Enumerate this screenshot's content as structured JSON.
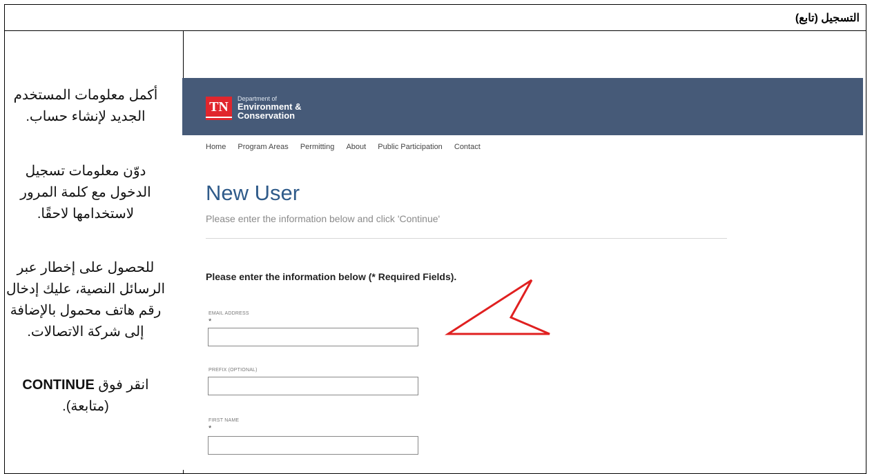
{
  "section_title": "التسجيل (تابع)",
  "instructions": {
    "p1": "أكمل معلومات المستخدم الجديد لإنشاء حساب.",
    "p2": "دوّن معلومات تسجيل الدخول مع كلمة المرور لاستخدامها لاحقًا.",
    "p3": "للحصول على إخطار عبر الرسائل النصية، عليك إدخال رقم هاتف محمول بالإضافة إلى شركة الاتصالات.",
    "p4_prefix": "انقر فوق",
    "p4_bold": "CONTINUE",
    "p4_suffix": "(متابعة)."
  },
  "screenshot": {
    "logo_text": "TN",
    "dept_line1": "Department of",
    "dept_line2": "Environment &",
    "dept_line3": "Conservation",
    "nav": [
      "Home",
      "Program Areas",
      "Permitting",
      "About",
      "Public Participation",
      "Contact"
    ],
    "heading": "New User",
    "subheading": "Please enter the information below and click 'Continue'",
    "required_note": "Please enter the information below (* Required Fields).",
    "fields": [
      {
        "label": "EMAIL ADDRESS",
        "required": "*",
        "value": ""
      },
      {
        "label": "PREFIX (OPTIONAL)",
        "required": "",
        "value": ""
      },
      {
        "label": "FIRST NAME",
        "required": "*",
        "value": ""
      }
    ],
    "header_color": "#465a78",
    "logo_color": "#e1262d",
    "arrow_color": "#e02020"
  }
}
